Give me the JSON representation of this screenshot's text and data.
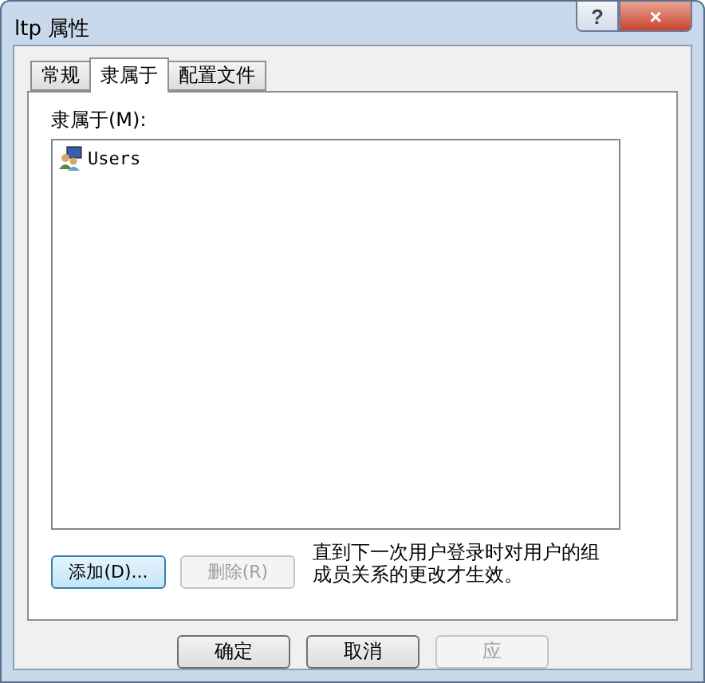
{
  "window": {
    "title": "ltp 属性",
    "help": "?",
    "close": "×"
  },
  "tabs": [
    {
      "label": "常规",
      "selected": false
    },
    {
      "label": "隶属于",
      "selected": true
    },
    {
      "label": "配置文件",
      "selected": false
    }
  ],
  "list_label": "隶属于(M):",
  "members": [
    {
      "name": "Users",
      "selected": false
    }
  ],
  "actions": [
    {
      "label": "添加(D)...",
      "disabled": false,
      "focused": true
    },
    {
      "label": "删除(R)",
      "disabled": true,
      "focused": false
    }
  ],
  "note": "直到下一次用户登录时对用户的组成员关系的更改才生效。",
  "buttons": [
    {
      "label": "确定",
      "disabled": false
    },
    {
      "label": "取消",
      "disabled": false
    },
    {
      "label": "应",
      "disabled": true
    }
  ]
}
